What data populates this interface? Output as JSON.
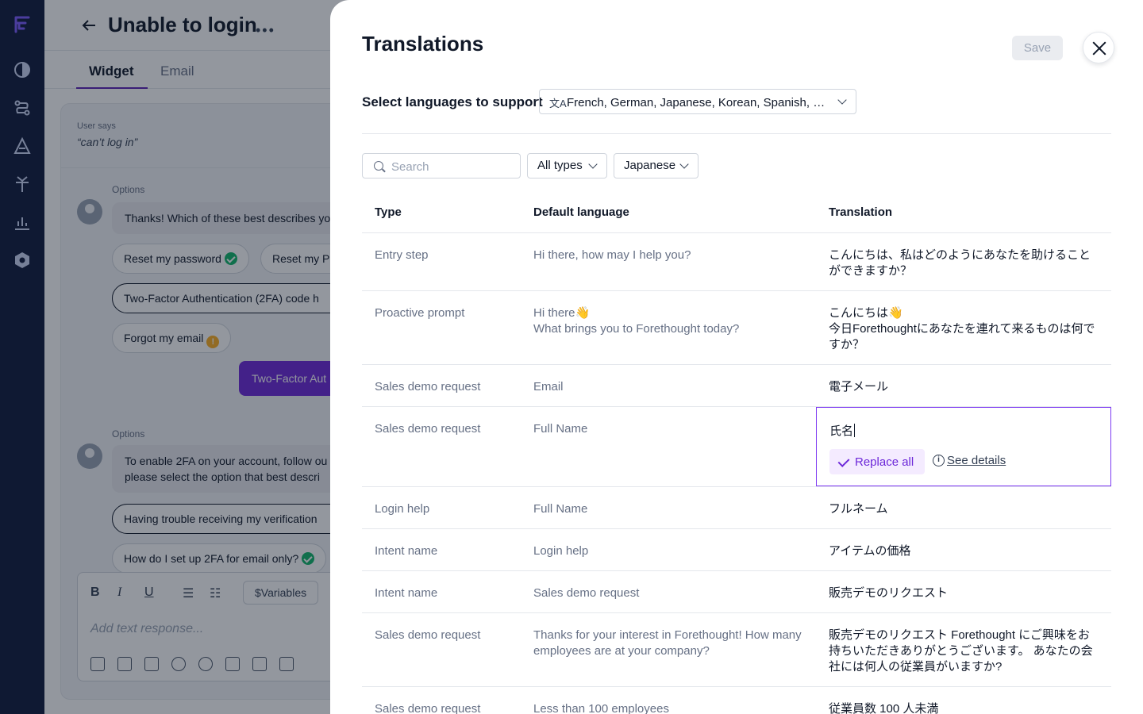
{
  "editor": {
    "title": "Unable to login",
    "tabs": [
      "Widget",
      "Email"
    ],
    "user_says_label": "User says",
    "user_says_quote": "“can’t log in”",
    "options_label": "Options",
    "message_1": "Thanks! Which of these best describes your issue?",
    "chips_1": [
      "Reset my password",
      "Reset my P",
      "Two-Factor Authentication (2FA) code h",
      "Forgot my email"
    ],
    "purple_button": "Two-Factor Aut",
    "message_2_line1": "To enable 2FA on your account, follow ou",
    "message_2_line2": "please select the option that best descri",
    "chips_2": [
      "Having trouble receiving my verification",
      "How do I set up 2FA for email only?"
    ],
    "variables_button": "$Variables",
    "editor_placeholder": "Add text response..."
  },
  "drawer": {
    "title": "Translations",
    "save_label": "Save",
    "languages_label": "Select languages to support",
    "languages_value": "French, German, Japanese, Korean, Spanish, Sw...",
    "search_placeholder": "Search",
    "type_filter": "All types",
    "language_filter": "Japanese",
    "columns": {
      "type": "Type",
      "default": "Default language",
      "translation": "Translation"
    },
    "rows": [
      {
        "type": "Entry step",
        "default": "Hi there, how may I help you?",
        "translation": "こんにちは、私はどのようにあなたを助けることができますか？"
      },
      {
        "type": "Proactive prompt",
        "default_line1": "Hi there👋",
        "default_line2": "What brings you to Forethought today?",
        "translation_line1": "こんにちは👋",
        "translation_line2": "今日Forethoughtにあなたを連れて来るものは何ですか？"
      },
      {
        "type": "Sales demo request",
        "default": "Email",
        "translation": "電子メール"
      },
      {
        "type": "Sales demo request",
        "default": "Full Name",
        "translation": "氏名",
        "replace_all": "Replace all",
        "see_details": "See details"
      },
      {
        "type": "Login help",
        "default": "Full Name",
        "translation": "フルネーム"
      },
      {
        "type": "Intent name",
        "default": "Login help",
        "translation": "アイテムの価格"
      },
      {
        "type": "Intent name",
        "default": "Sales demo request",
        "translation": "販売デモのリクエスト"
      },
      {
        "type": "Sales demo request",
        "default": "Thanks for your interest in Forethought! How many employees are at your company?",
        "translation": "販売デモのリクエスト Forethought にご興味をお持ちいただきありがとうございます。 あなたの会社には何人の従業員がいますか?"
      },
      {
        "type": "Sales demo request",
        "default": "Less than 100 employees",
        "translation": "従業員数 100 人未満"
      }
    ]
  },
  "colors": {
    "rail": "#101a3d",
    "accent": "#6d28d9",
    "edit_border": "#7e3af2"
  }
}
